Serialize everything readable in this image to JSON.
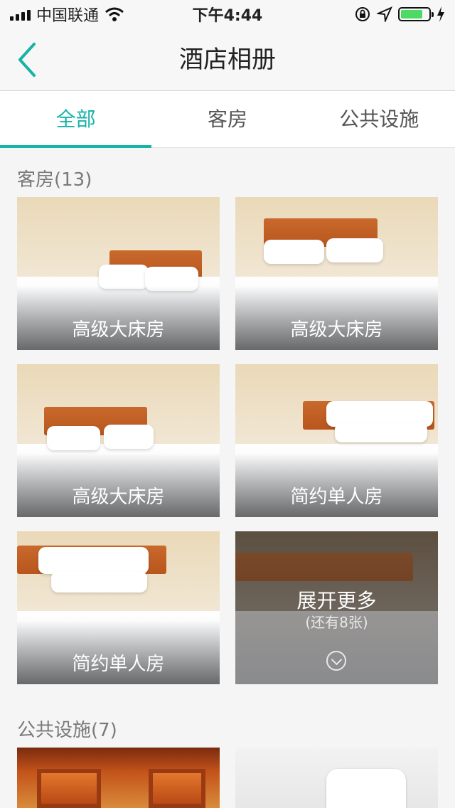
{
  "status_bar": {
    "carrier": "中国联通",
    "time": "下午4:44",
    "battery_level": 0.8,
    "battery_color": "#4cd964"
  },
  "nav": {
    "title": "酒店相册",
    "back_icon": "chevron-left-icon",
    "accent": "#16b3a7"
  },
  "tabs": [
    {
      "label": "全部",
      "active": true
    },
    {
      "label": "客房",
      "active": false
    },
    {
      "label": "公共设施",
      "active": false
    }
  ],
  "rooms_section": {
    "title": "客房(13)",
    "photos": [
      {
        "label": "高级大床房"
      },
      {
        "label": "高级大床房"
      },
      {
        "label": "高级大床房"
      },
      {
        "label": "简约单人房"
      },
      {
        "label": "简约单人房"
      }
    ],
    "more": {
      "title": "展开更多",
      "subtitle": "(还有8张)",
      "icon": "chevron-down-circle-icon"
    }
  },
  "facilities_section": {
    "title": "公共设施(7)"
  }
}
